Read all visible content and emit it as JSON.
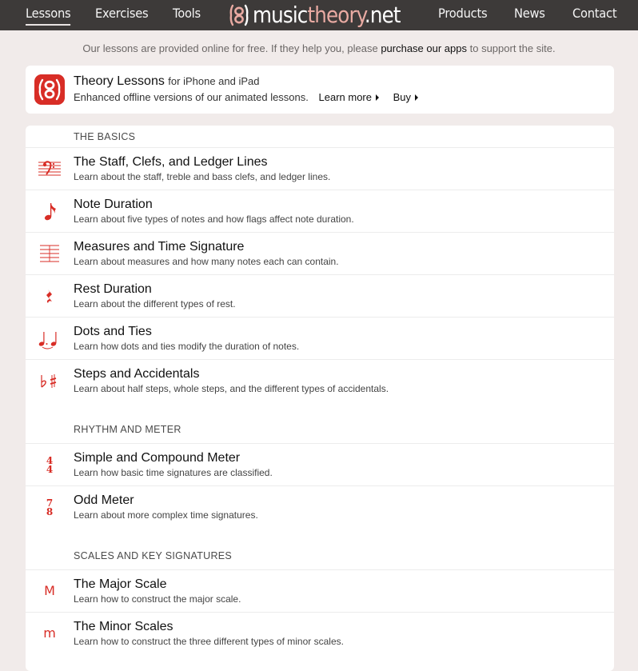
{
  "nav": {
    "lessons": "Lessons",
    "exercises": "Exercises",
    "tools": "Tools",
    "logo_music": "music",
    "logo_theory": "theory",
    "logo_net": ".net",
    "products": "Products",
    "news": "News",
    "contact": "Contact"
  },
  "promo": {
    "before": "Our lessons are provided online for free. If they help you, please ",
    "link": "purchase our apps",
    "after": " to support the site."
  },
  "app": {
    "title": "Theory Lessons",
    "platforms": "for iPhone and iPad",
    "description": "Enhanced offline versions of our animated lessons.",
    "learn_more": "Learn more",
    "buy": "Buy"
  },
  "sections": {
    "basics": {
      "heading": "THE BASICS",
      "items": [
        {
          "title": "The Staff, Clefs, and Ledger Lines",
          "desc": "Learn about the staff, treble and bass clefs, and ledger lines.",
          "icon": "bass-clef-icon"
        },
        {
          "title": "Note Duration",
          "desc": "Learn about five types of notes and how flags affect note duration.",
          "icon": "eighth-note-icon"
        },
        {
          "title": "Measures and Time Signature",
          "desc": "Learn about measures and how many notes each can contain.",
          "icon": "staff-lines-icon"
        },
        {
          "title": "Rest Duration",
          "desc": "Learn about the different types of rest.",
          "icon": "quarter-rest-icon"
        },
        {
          "title": "Dots and Ties",
          "desc": "Learn how dots and ties modify the duration of notes.",
          "icon": "tied-notes-icon"
        },
        {
          "title": "Steps and Accidentals",
          "desc": "Learn about half steps, whole steps, and the different types of accidentals.",
          "icon": "flat-sharp-icon"
        }
      ]
    },
    "rhythm": {
      "heading": "RHYTHM AND METER",
      "items": [
        {
          "title": "Simple and Compound Meter",
          "desc": "Learn how basic time signatures are classified.",
          "icon": "time-signature-4-4-icon",
          "top": "4",
          "bottom": "4"
        },
        {
          "title": "Odd Meter",
          "desc": "Learn about more complex time signatures.",
          "icon": "time-signature-7-8-icon",
          "top": "7",
          "bottom": "8"
        }
      ]
    },
    "scales": {
      "heading": "SCALES AND KEY SIGNATURES",
      "items": [
        {
          "title": "The Major Scale",
          "desc": "Learn how to construct the major scale.",
          "icon": "major-letter-icon",
          "letter": "M"
        },
        {
          "title": "The Minor Scales",
          "desc": "Learn how to construct the three different types of minor scales.",
          "icon": "minor-letter-icon",
          "letter": "m"
        }
      ]
    }
  },
  "colors": {
    "accent": "#d82d26",
    "nav_bg": "#3d3a39",
    "page_bg": "#f1ebea",
    "logo_theory": "#e9aaa2"
  }
}
